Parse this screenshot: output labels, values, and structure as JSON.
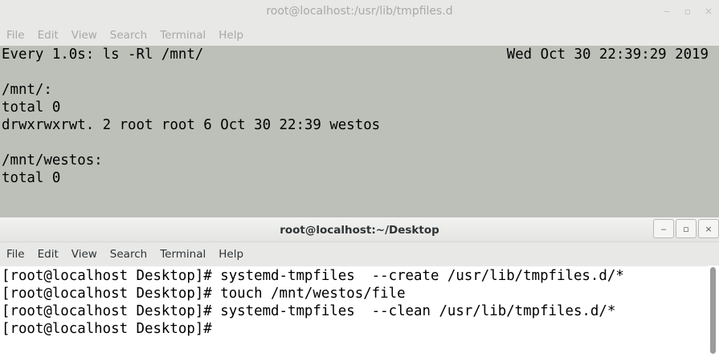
{
  "back_window": {
    "title": "root@localhost:/usr/lib/tmpfiles.d",
    "controls": {
      "minimize": "‒",
      "maximize": "▫",
      "close": "×"
    },
    "menu": [
      "File",
      "Edit",
      "View",
      "Search",
      "Terminal",
      "Help"
    ],
    "watch_header_left": "Every 1.0s: ls -Rl /mnt/",
    "watch_header_right": "Wed Oct 30 22:39:29 2019",
    "lines": [
      "",
      "/mnt/:",
      "total 0",
      "drwxrwxrwt. 2 root root 6 Oct 30 22:39 westos",
      "",
      "/mnt/westos:",
      "total 0"
    ]
  },
  "front_window": {
    "title": "root@localhost:~/Desktop",
    "controls": {
      "minimize": "‒",
      "maximize": "▫",
      "close": "×"
    },
    "menu": [
      "File",
      "Edit",
      "View",
      "Search",
      "Terminal",
      "Help"
    ],
    "lines": [
      "[root@localhost Desktop]# systemd-tmpfiles  --create /usr/lib/tmpfiles.d/*",
      "[root@localhost Desktop]# touch /mnt/westos/file",
      "[root@localhost Desktop]# systemd-tmpfiles  --clean /usr/lib/tmpfiles.d/*",
      "[root@localhost Desktop]#"
    ]
  },
  "colors": {
    "back_terminal_bg": "#bdbfb9",
    "front_terminal_bg": "#ffffff",
    "text": "#000000"
  }
}
